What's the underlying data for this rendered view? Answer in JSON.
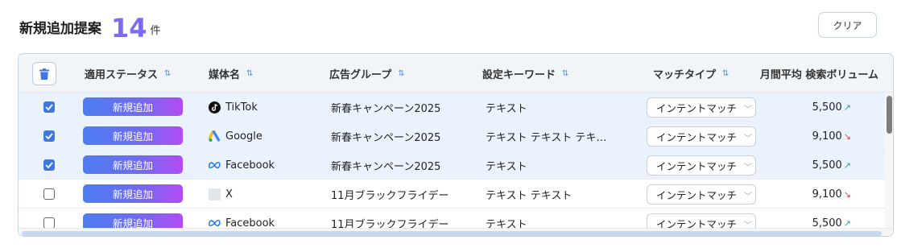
{
  "header": {
    "title": "新規追加提案",
    "count": "14",
    "count_unit": "件",
    "clear_label": "クリア"
  },
  "columns": {
    "status": "適用ステータス",
    "media": "媒体名",
    "ad_group": "広告グループ",
    "keyword": "設定キーワード",
    "match_type": "マッチタイプ",
    "volume": "月間平均 検索ボリューム",
    "sort_icon": "sort-icon"
  },
  "rows": [
    {
      "checked": true,
      "status": "新規追加",
      "media": "TikTok",
      "media_icon": "tiktok-icon",
      "ad_group": "新春キャンペーン2025",
      "keyword": "テキスト",
      "match_type": "インテントマッチ",
      "volume": "5,500",
      "trend": "up"
    },
    {
      "checked": true,
      "status": "新規追加",
      "media": "Google",
      "media_icon": "google-ads-icon",
      "ad_group": "新春キャンペーン2025",
      "keyword": "テキスト テキスト テキ…",
      "match_type": "インテントマッチ",
      "volume": "9,100",
      "trend": "down"
    },
    {
      "checked": true,
      "status": "新規追加",
      "media": "Facebook",
      "media_icon": "meta-icon",
      "ad_group": "新春キャンペーン2025",
      "keyword": "テキスト",
      "match_type": "インテントマッチ",
      "volume": "5,500",
      "trend": "up"
    },
    {
      "checked": false,
      "status": "新規追加",
      "media": "X",
      "media_icon": "x-icon",
      "ad_group": "11月ブラックフライデー",
      "keyword": "テキスト テキスト",
      "match_type": "インテントマッチ",
      "volume": "9,100",
      "trend": "down"
    },
    {
      "checked": false,
      "status": "新規追加",
      "media": "Facebook",
      "media_icon": "meta-icon",
      "ad_group": "11月ブラックフライデー",
      "keyword": "テキスト",
      "match_type": "インテントマッチ",
      "volume": "5,500",
      "trend": "up"
    }
  ],
  "colors": {
    "accent": "#7b6cf0",
    "checkbox": "#3f76e0",
    "status_gradient_start": "#4d7df0",
    "status_gradient_end": "#b24bf5",
    "trend_up": "#27a6b0",
    "trend_down": "#e0443a"
  }
}
